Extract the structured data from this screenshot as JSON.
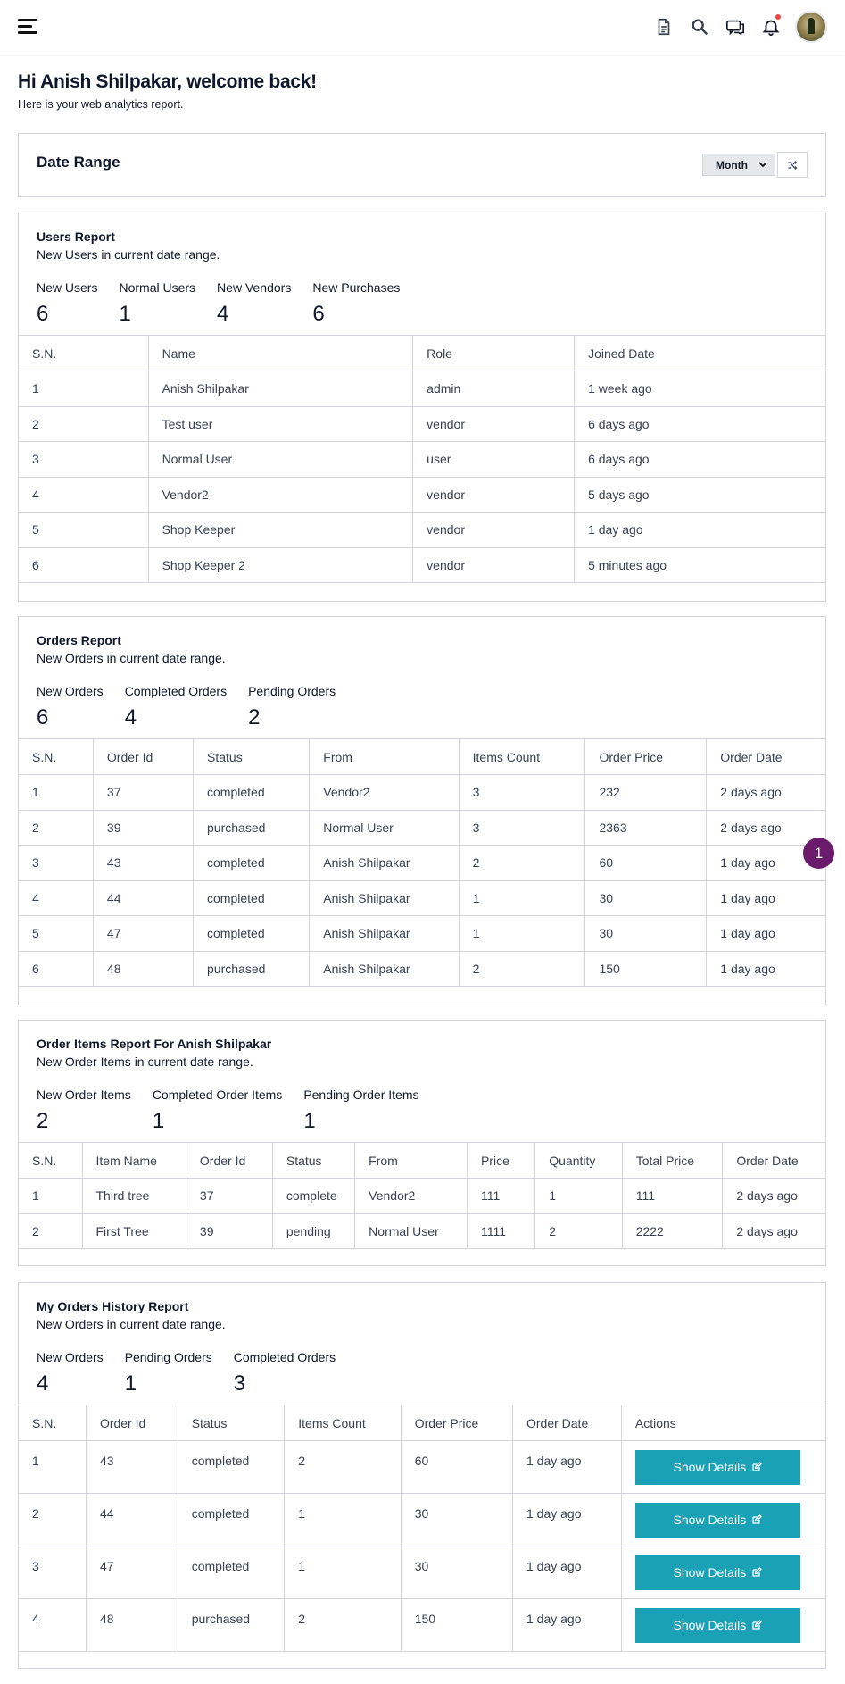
{
  "header": {
    "menu_icon": "hamburger-icon",
    "icons": [
      "document-icon",
      "search-icon",
      "chat-icon",
      "bell-icon",
      "avatar"
    ]
  },
  "welcome": {
    "title": "Hi Anish Shilpakar, welcome back!",
    "subtitle": "Here is your web analytics report."
  },
  "date_range": {
    "title": "Date Range",
    "select_value": "Month",
    "shuffle_icon": "shuffle-icon"
  },
  "users_report": {
    "title": "Users Report",
    "subtitle": "New Users in current date range.",
    "stats": [
      {
        "label": "New Users",
        "value": "6"
      },
      {
        "label": "Normal Users",
        "value": "1"
      },
      {
        "label": "New Vendors",
        "value": "4"
      },
      {
        "label": "New Purchases",
        "value": "6"
      }
    ],
    "columns": [
      "S.N.",
      "Name",
      "Role",
      "Joined Date"
    ],
    "rows": [
      [
        "1",
        "Anish Shilpakar",
        "admin",
        "1 week ago"
      ],
      [
        "2",
        "Test user",
        "vendor",
        "6 days ago"
      ],
      [
        "3",
        "Normal User",
        "user",
        "6 days ago"
      ],
      [
        "4",
        "Vendor2",
        "vendor",
        "5 days ago"
      ],
      [
        "5",
        "Shop Keeper",
        "vendor",
        "1 day ago"
      ],
      [
        "6",
        "Shop Keeper 2",
        "vendor",
        "5 minutes ago"
      ]
    ]
  },
  "orders_report": {
    "title": "Orders Report",
    "subtitle": "New Orders in current date range.",
    "stats": [
      {
        "label": "New Orders",
        "value": "6"
      },
      {
        "label": "Completed Orders",
        "value": "4"
      },
      {
        "label": "Pending Orders",
        "value": "2"
      }
    ],
    "columns": [
      "S.N.",
      "Order Id",
      "Status",
      "From",
      "Items Count",
      "Order Price",
      "Order Date"
    ],
    "rows": [
      [
        "1",
        "37",
        "completed",
        "Vendor2",
        "3",
        "232",
        "2 days ago"
      ],
      [
        "2",
        "39",
        "purchased",
        "Normal User",
        "3",
        "2363",
        "2 days ago"
      ],
      [
        "3",
        "43",
        "completed",
        "Anish Shilpakar",
        "2",
        "60",
        "1 day ago"
      ],
      [
        "4",
        "44",
        "completed",
        "Anish Shilpakar",
        "1",
        "30",
        "1 day ago"
      ],
      [
        "5",
        "47",
        "completed",
        "Anish Shilpakar",
        "1",
        "30",
        "1 day ago"
      ],
      [
        "6",
        "48",
        "purchased",
        "Anish Shilpakar",
        "2",
        "150",
        "1 day ago"
      ]
    ]
  },
  "order_items_report": {
    "title": "Order Items Report For Anish Shilpakar",
    "subtitle": "New Order Items in current date range.",
    "stats": [
      {
        "label": "New Order Items",
        "value": "2"
      },
      {
        "label": "Completed Order Items",
        "value": "1"
      },
      {
        "label": "Pending Order Items",
        "value": "1"
      }
    ],
    "columns": [
      "S.N.",
      "Item Name",
      "Order Id",
      "Status",
      "From",
      "Price",
      "Quantity",
      "Total Price",
      "Order Date"
    ],
    "rows": [
      [
        "1",
        "Third tree",
        "37",
        "complete",
        "Vendor2",
        "111",
        "1",
        "111",
        "2 days ago"
      ],
      [
        "2",
        "First Tree",
        "39",
        "pending",
        "Normal User",
        "1111",
        "2",
        "2222",
        "2 days ago"
      ]
    ]
  },
  "history_report": {
    "title": "My Orders History Report",
    "subtitle": "New Orders in current date range.",
    "stats": [
      {
        "label": "New Orders",
        "value": "4"
      },
      {
        "label": "Pending Orders",
        "value": "1"
      },
      {
        "label": "Completed Orders",
        "value": "3"
      }
    ],
    "columns": [
      "S.N.",
      "Order Id",
      "Status",
      "Items Count",
      "Order Price",
      "Order Date",
      "Actions"
    ],
    "rows": [
      [
        "1",
        "43",
        "completed",
        "2",
        "60",
        "1 day ago"
      ],
      [
        "2",
        "44",
        "completed",
        "1",
        "30",
        "1 day ago"
      ],
      [
        "3",
        "47",
        "completed",
        "1",
        "30",
        "1 day ago"
      ],
      [
        "4",
        "48",
        "purchased",
        "2",
        "150",
        "1 day ago"
      ]
    ],
    "action_label": "Show Details",
    "action_icon": "edit-icon"
  },
  "floating_badge": "1"
}
